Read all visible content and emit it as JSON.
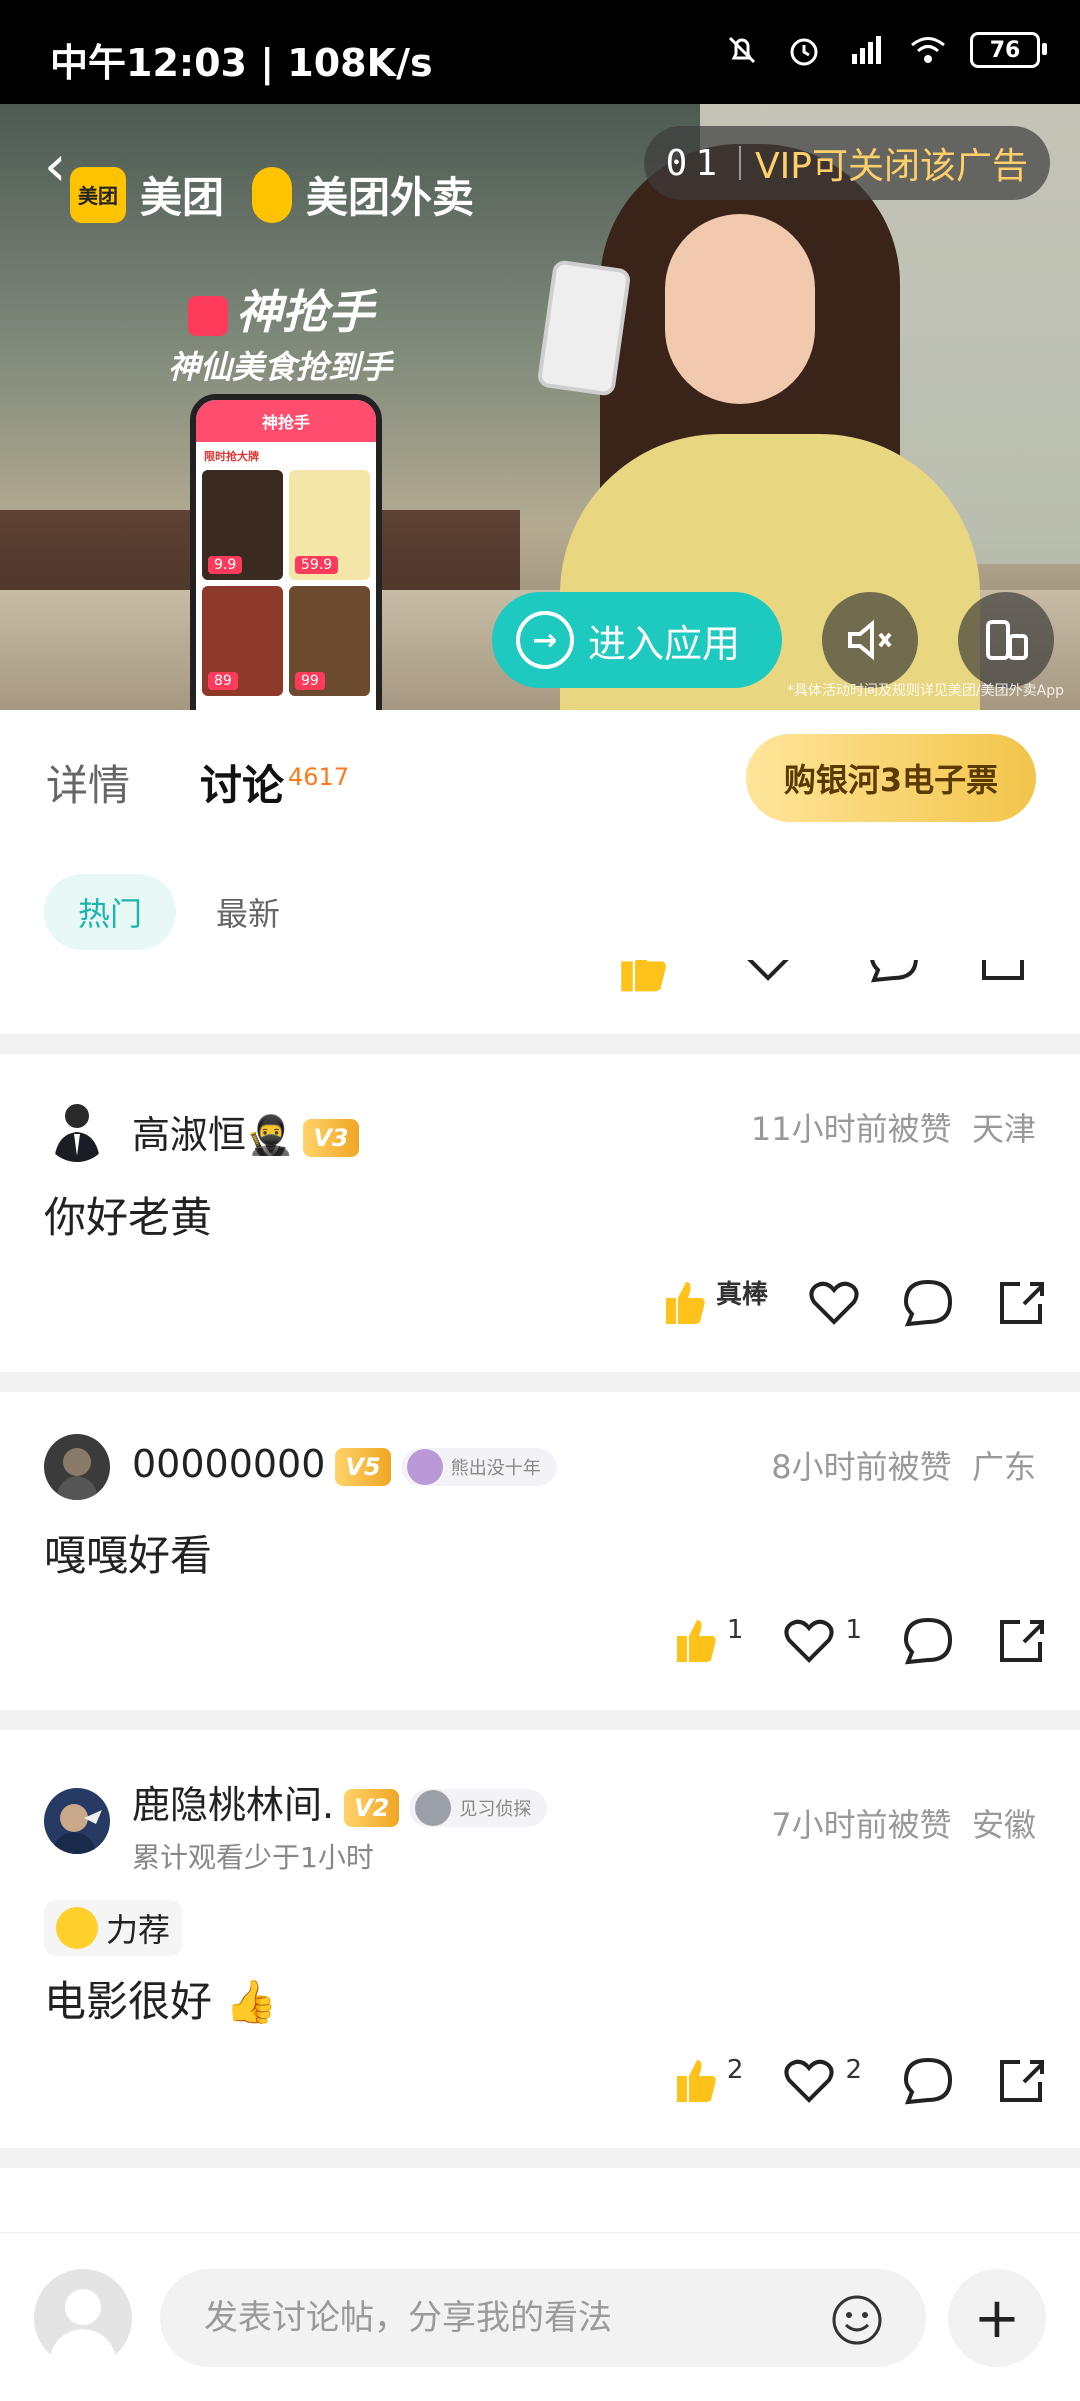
{
  "status_bar": {
    "time": "中午12:03 | 108K/s",
    "battery": "76"
  },
  "ad": {
    "brand1": "美团",
    "brand1_logo": "美团",
    "brand2": "美团外卖",
    "slogan1": "神抢手",
    "slogan2": "神仙美食抢到手",
    "mini_app_title": "神抢手",
    "mini_app_section": "限时抢大牌",
    "mini_prices": [
      "9.9",
      "59.9",
      "89",
      "99"
    ],
    "countdown": "01",
    "vip_text": "VIP可关闭该广告",
    "enter_label": "进入应用",
    "disclaimer": "*具体活动时间及规则详见美团/美团外卖App"
  },
  "tabs": {
    "details": "详情",
    "discuss": "讨论",
    "discuss_count": "4617",
    "buy": "购银河3电子票"
  },
  "filters": {
    "hot": "热门",
    "latest": "最新"
  },
  "posts": [
    {
      "name": "高淑恒🥷",
      "level": "V3",
      "time": "11小时前被赞",
      "region": "天津",
      "content": "你好老黄",
      "thumb_label": "真棒",
      "like_count": "",
      "heart_count": ""
    },
    {
      "name": "00000000",
      "level": "V5",
      "medal": "熊出没十年",
      "time": "8小时前被赞",
      "region": "广东",
      "content": "嘎嘎好看",
      "like_count": "1",
      "heart_count": "1"
    },
    {
      "name": "鹿隐桃林间.",
      "level": "V2",
      "medal": "见习侦探",
      "sub": "累计观看少于1小时",
      "time": "7小时前被赞",
      "region": "安徽",
      "tag": "力荐",
      "content": "电影很好 👍",
      "like_count": "2",
      "heart_count": "2"
    }
  ],
  "composer": {
    "placeholder": "发表讨论帖，分享我的看法",
    "plus": "+"
  }
}
